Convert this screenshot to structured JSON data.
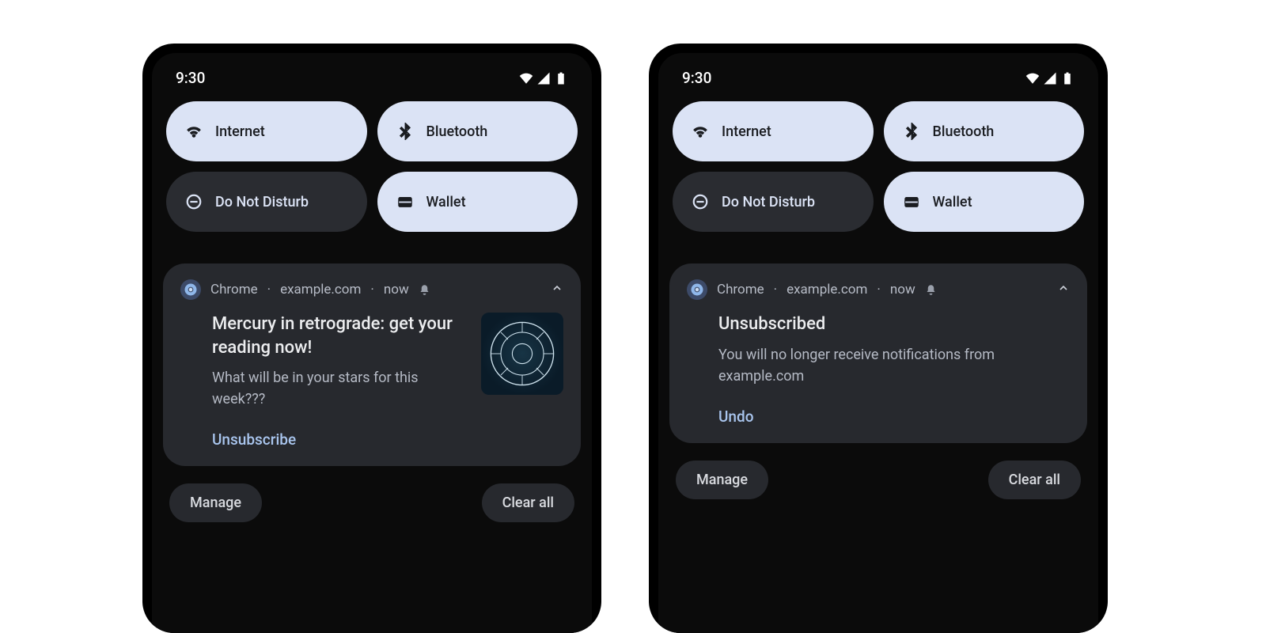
{
  "status": {
    "time": "9:30"
  },
  "qs": {
    "internet": "Internet",
    "bluetooth": "Bluetooth",
    "dnd": "Do Not Disturb",
    "wallet": "Wallet"
  },
  "notif_header": {
    "app": "Chrome",
    "site": "example.com",
    "when": "now"
  },
  "phones": [
    {
      "title": "Mercury in retrograde: get your reading now!",
      "subtitle": "What will be in your stars for this week???",
      "action": "Unsubscribe",
      "has_thumb": true
    },
    {
      "title": "Unsubscribed",
      "subtitle": "You will no longer receive notifications from example.com",
      "action": "Undo",
      "has_thumb": false
    }
  ],
  "footer": {
    "manage": "Manage",
    "clear": "Clear all"
  }
}
